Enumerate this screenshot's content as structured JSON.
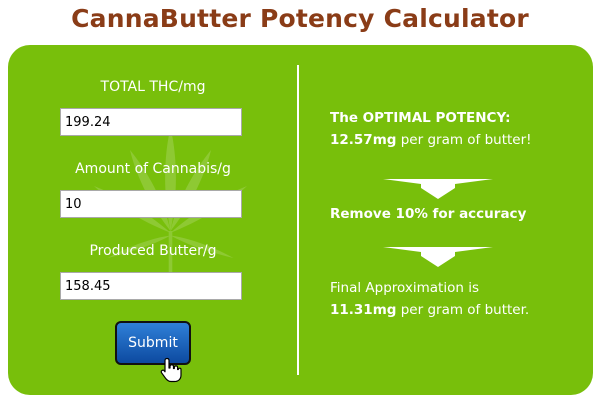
{
  "header": {
    "title": "CannaButter Potency Calculator"
  },
  "form": {
    "thc_label": "TOTAL THC/mg",
    "thc_value": "199.24",
    "cannabis_label": "Amount of Cannabis/g",
    "cannabis_value": "10",
    "butter_label": "Produced Butter/g",
    "butter_value": "158.45",
    "submit_label": "Submit"
  },
  "results": {
    "optimal_heading": "The OPTIMAL POTENCY:",
    "optimal_value": "12.57mg",
    "optimal_suffix": " per gram of butter!",
    "adjust_note": "Remove 10% for accuracy",
    "final_heading": "Final Approximation is",
    "final_value": "11.31mg",
    "final_suffix": " per gram of butter."
  },
  "colors": {
    "title": "#8a3c17",
    "panel": "#78bf0b",
    "button": "#1a5fbf"
  },
  "icons": {
    "background": "cannabis-leaf-icon",
    "arrows": "arrow-down-icon",
    "cursor": "hand-pointer-icon"
  }
}
